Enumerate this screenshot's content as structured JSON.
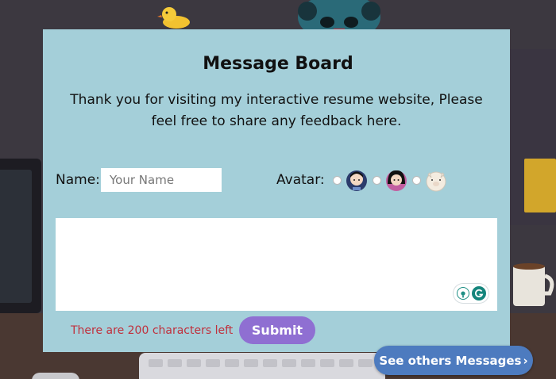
{
  "board": {
    "title": "Message Board",
    "description": "Thank you for visiting my interactive resume website, Please feel free to share any feedback here."
  },
  "form": {
    "name_label": "Name:",
    "name_value": "",
    "name_placeholder": "Your Name",
    "avatar_label": "Avatar:",
    "avatars": [
      {
        "icon": "boy-avatar-icon",
        "selected": false
      },
      {
        "icon": "girl-avatar-icon",
        "selected": false
      },
      {
        "icon": "pig-avatar-icon",
        "selected": false
      }
    ],
    "message_value": "",
    "char_count_text": "There are 200 characters left",
    "submit_label": "Submit"
  },
  "others_button": {
    "label": "See others Messages",
    "chevron": "›"
  },
  "colors": {
    "panel_bg": "#a4cfd9",
    "submit_bg": "#8f6fd2",
    "others_bg": "#4d7bbf",
    "warning_text": "#c0303c",
    "page_bg": "#3c3840"
  }
}
